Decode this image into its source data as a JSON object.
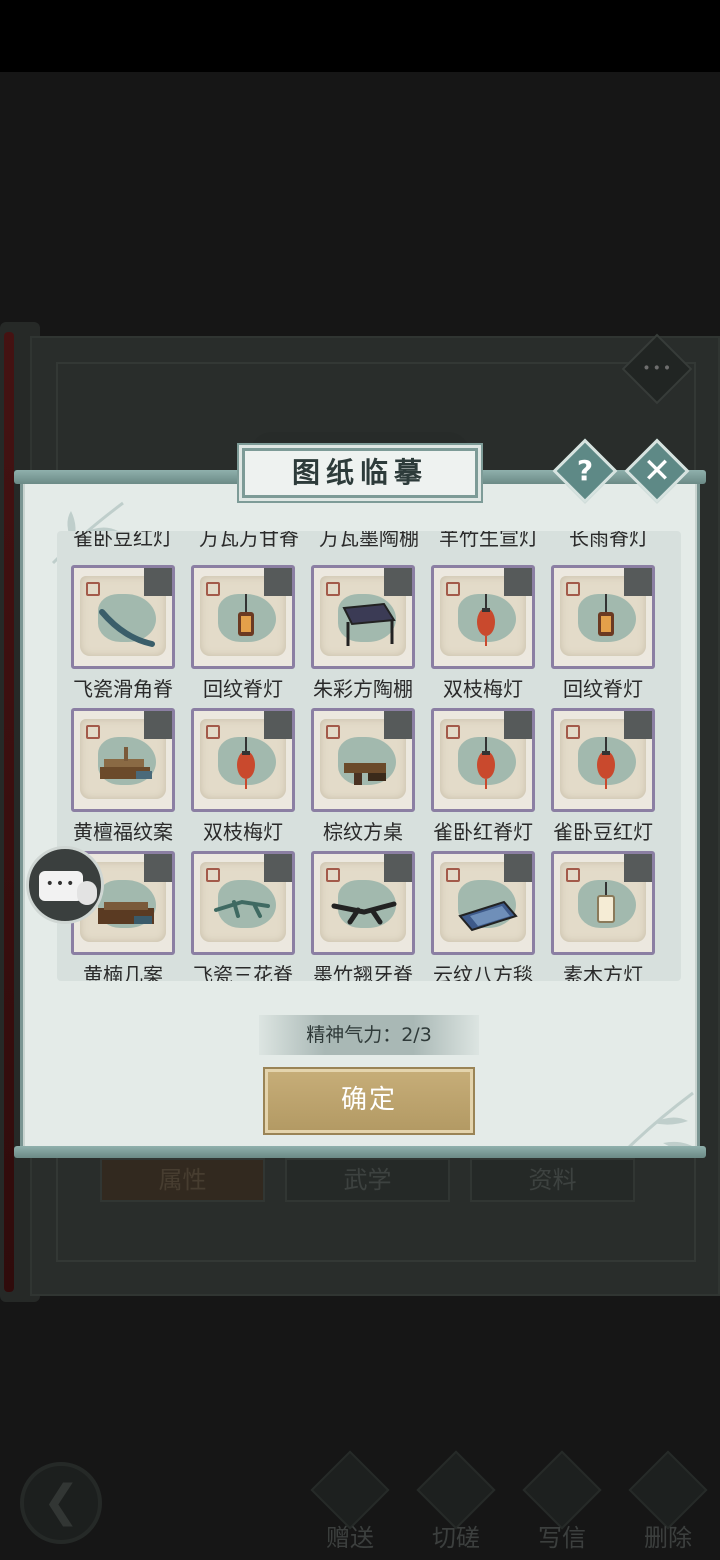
{
  "background": {
    "tabs": [
      "属性",
      "武学",
      "资料"
    ],
    "actions": [
      "赠送",
      "切磋",
      "写信",
      "删除"
    ]
  },
  "dialog": {
    "title": "图纸临摹",
    "help_label": "?",
    "close_label": "✕",
    "cut_row": [
      "雀卧豆红灯",
      "万瓦万甘脊",
      "万瓦墨陶棚",
      "羊竹生宣灯",
      "长雨脊灯"
    ],
    "items": [
      {
        "label": "飞瓷滑角脊",
        "kind": "ridge"
      },
      {
        "label": "回纹脊灯",
        "kind": "lamp-dark"
      },
      {
        "label": "朱彩方陶棚",
        "kind": "canopy"
      },
      {
        "label": "双枝梅灯",
        "kind": "lamp-red"
      },
      {
        "label": "回纹脊灯",
        "kind": "lamp-dark"
      },
      {
        "label": "黄檀福纹案",
        "kind": "desk"
      },
      {
        "label": "双枝梅灯",
        "kind": "lamp-red"
      },
      {
        "label": "棕纹方桌",
        "kind": "table"
      },
      {
        "label": "雀卧红脊灯",
        "kind": "lamp-red"
      },
      {
        "label": "雀卧豆红灯",
        "kind": "lamp-red"
      },
      {
        "label": "黄楠几案",
        "kind": "desk2"
      },
      {
        "label": "飞瓷三花脊",
        "kind": "ridge3"
      },
      {
        "label": "墨竹翘牙脊",
        "kind": "ridge-dark"
      },
      {
        "label": "云纹八方毯",
        "kind": "rug"
      },
      {
        "label": "素木方灯",
        "kind": "lamp-white"
      }
    ],
    "stamina": "精神气力：2/3",
    "confirm_label": "确定"
  },
  "colors": {
    "accent_teal": "#5e8986",
    "confirm_gold": "#b39a64",
    "card_border": "#8b7fa3"
  }
}
